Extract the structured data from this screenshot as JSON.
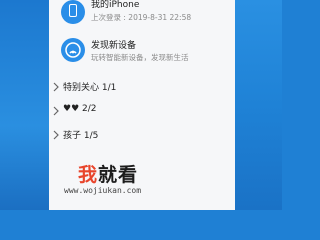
{
  "device": {
    "name": "我的iPhone",
    "last_login": "上次登录 : 2019-8-31 22:58",
    "icon": "phone-icon"
  },
  "discover": {
    "title": "发现新设备",
    "subtitle": "玩转智能新设备，发现新生活",
    "icon": "wifi-signal-icon"
  },
  "groups": [
    {
      "label": "特别关心 1/1"
    },
    {
      "label": "♥♥ 2/2"
    },
    {
      "label": "孩子 1/5"
    }
  ],
  "watermark": {
    "brand_part1": "我",
    "brand_part2": "就看",
    "url": "www.wojiukan.com"
  },
  "colors": {
    "desktop_blue": "#1f80d4",
    "panel_bg": "#f6f7f9",
    "icon_blue": "#2a8ee8",
    "brand_red": "#e8452c"
  }
}
